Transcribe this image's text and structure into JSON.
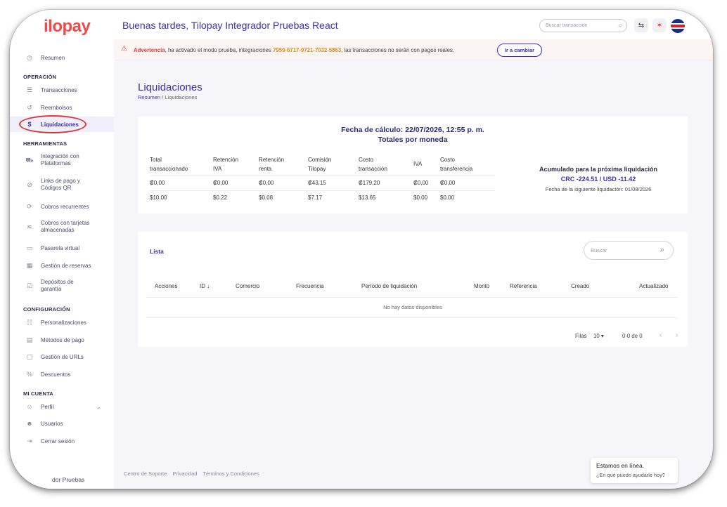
{
  "brand": {
    "logo_text": "ilopay",
    "accent": "#3b2fb0",
    "danger": "#e33d3d"
  },
  "header": {
    "greeting": "Buenas tardes, Tilopay Integrador Pruebas React",
    "search_placeholder": "Buscar transacción",
    "icons": [
      "search-icon",
      "exchange-icon",
      "activity-icon",
      "costa-rica-flag-icon"
    ]
  },
  "warning": {
    "label": "Advertencia",
    "text_before": ", ha activado el modo prueba, integraciones ",
    "code": "7959-6717-9721-7032-5863",
    "text_after": ", las transacciones no serán con pagos reales.",
    "button": "Ir a cambiar"
  },
  "sidebar": {
    "summary": "Resumen",
    "sections": {
      "operacion": "OPERACIÓN",
      "herramientas": "HERRAMIENTAS",
      "configuracion": "CONFIGURACIÓN",
      "mi_cuenta": "MI CUENTA"
    },
    "operacion": [
      "Transacciones",
      "Reembolsos",
      "Liquidaciones"
    ],
    "herramientas": [
      [
        "Integración con",
        "Plataformas"
      ],
      [
        "Links de pago y",
        "Códigos QR"
      ],
      [
        "Cobros recurrentes"
      ],
      [
        "Cobros con tarjetas",
        "almacenadas"
      ],
      [
        "Pasarela virtual"
      ],
      [
        "Gestión de reservas"
      ],
      [
        "Depósitos de",
        "garantía"
      ]
    ],
    "configuracion": [
      "Personalizaciones",
      "Métodos de pago",
      "Gestión de URLs",
      "Descuentos"
    ],
    "mi_cuenta": [
      "Perfil",
      "Usuarios",
      "Cerrar sesión"
    ],
    "bottom_user": "dor Pruebas"
  },
  "page": {
    "title": "Liquidaciones",
    "breadcrumb": [
      "Resumen",
      "Liquidaciones"
    ],
    "breadcrumb_sep": "/"
  },
  "summary": {
    "calc_line": "Fecha de cálculo: 22/07/2026, 12:55 p. m.",
    "subtitle": "Totales por moneda",
    "headers": [
      [
        "Total",
        "transaccionado"
      ],
      [
        "Retención",
        "IVA"
      ],
      [
        "Retención",
        "renta"
      ],
      [
        "Comisión",
        "Tilopay"
      ],
      [
        "Costo",
        "transacción"
      ],
      [
        "IVA"
      ],
      [
        "Costo",
        "transferencia"
      ]
    ],
    "rows": [
      [
        "₡0,00",
        "₡0,00",
        "₡0,00",
        "₡43,15",
        "₡179,20",
        "₡0,00",
        "₡0,00"
      ],
      [
        "$10.00",
        "$0.22",
        "$0.08",
        "$7.17",
        "$13.65",
        "$0.00",
        "$0.00"
      ]
    ],
    "accumulated_title": "Acumulado para la próxima liquidación",
    "accumulated_value": "CRC -224.51 / USD -11.42",
    "next_date": "Fecha de la siguiente liquidación: 01/08/2026"
  },
  "list": {
    "title": "Lista",
    "search_placeholder": "Buscar",
    "columns": [
      "Acciones",
      "ID ↓",
      "Comercio",
      "Frecuencia",
      "Período de liquidación",
      "Monto",
      "Referencia",
      "Creado",
      "Actualizado"
    ],
    "empty": "No hay datos disponibles",
    "rows_label": "Filas",
    "rows_value": "10",
    "range": "0-0 de 0"
  },
  "footer": [
    "Centro de Soporte",
    "Privacidad",
    "Términos y Condiciones"
  ],
  "chat": {
    "title": "Estamos en línea.",
    "subtitle": "¿En qué puedo ayudarle hoy?"
  }
}
